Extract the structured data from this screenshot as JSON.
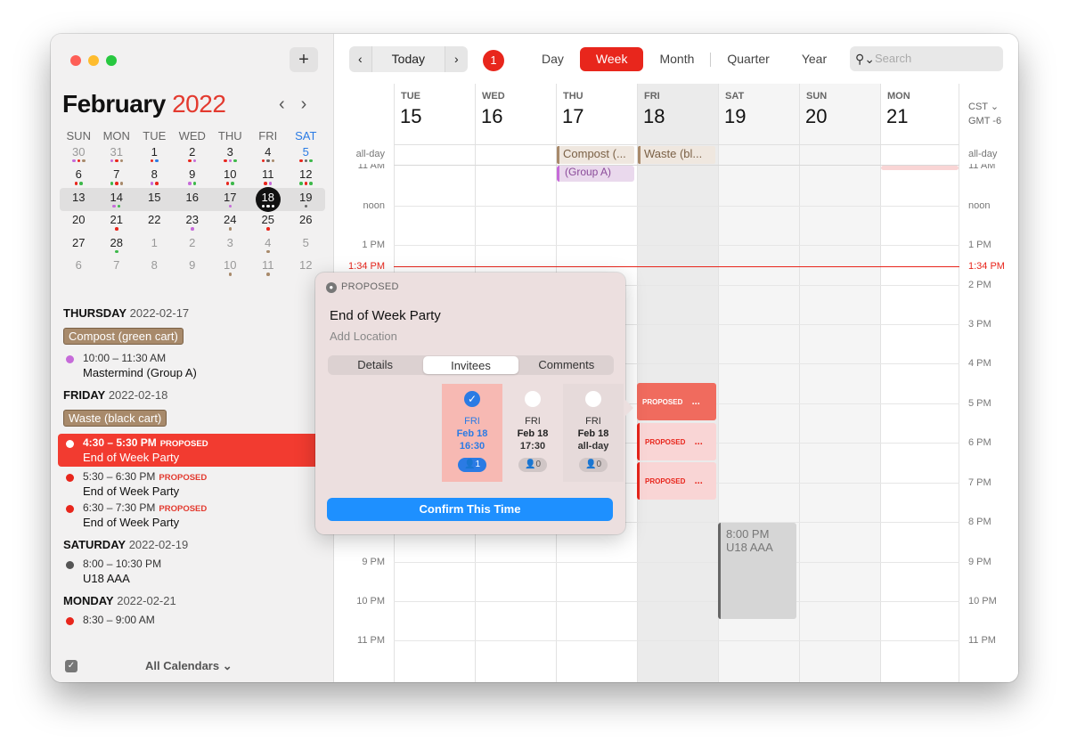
{
  "sidebar": {
    "add_label": "+",
    "month": "February",
    "year": "2022",
    "prev": "‹",
    "next": "›",
    "weekday_headers": [
      "SUN",
      "MON",
      "TUE",
      "WED",
      "THU",
      "FRI",
      "SAT"
    ],
    "weeks": [
      [
        {
          "d": "30",
          "out": true,
          "dots": [
            "#c66bd9",
            "#e8261c",
            "#a88a6b"
          ]
        },
        {
          "d": "31",
          "out": true,
          "dots": [
            "#c66bd9",
            "#e8261c",
            "#a88a6b"
          ]
        },
        {
          "d": "1",
          "dots": [
            "#e8261c",
            "#2b7be4"
          ]
        },
        {
          "d": "2",
          "dots": [
            "#e8261c",
            "#c66bd9"
          ]
        },
        {
          "d": "3",
          "dots": [
            "#e8261c",
            "#c66bd9",
            "#3db84a"
          ]
        },
        {
          "d": "4",
          "dots": [
            "#e8261c",
            "#666",
            "#a88a6b"
          ]
        },
        {
          "d": "5",
          "sat": true,
          "dots": [
            "#e8261c",
            "#666",
            "#3db84a"
          ]
        }
      ],
      [
        {
          "d": "6",
          "dots": [
            "#e8261c",
            "#3db84a"
          ]
        },
        {
          "d": "7",
          "dots": [
            "#3db84a",
            "#e8261c",
            "#a88a6b"
          ]
        },
        {
          "d": "8",
          "dots": [
            "#c66bd9",
            "#e8261c"
          ]
        },
        {
          "d": "9",
          "dots": [
            "#c66bd9",
            "#3db84a"
          ]
        },
        {
          "d": "10",
          "dots": [
            "#e8261c",
            "#3db84a"
          ]
        },
        {
          "d": "11",
          "dots": [
            "#e8261c",
            "#c66bd9"
          ]
        },
        {
          "d": "12",
          "dots": [
            "#3db84a",
            "#e8261c",
            "#3db84a"
          ]
        }
      ],
      [
        {
          "d": "13",
          "dots": []
        },
        {
          "d": "14",
          "dots": [
            "#c66bd9",
            "#3db84a"
          ]
        },
        {
          "d": "15",
          "dots": []
        },
        {
          "d": "16",
          "dots": []
        },
        {
          "d": "17",
          "dots": [
            "#c66bd9"
          ]
        },
        {
          "d": "18",
          "today": true,
          "dots": [
            "#fff",
            "#fff",
            "#fff"
          ]
        },
        {
          "d": "19",
          "dots": [
            "#666"
          ]
        }
      ],
      [
        {
          "d": "20",
          "dots": []
        },
        {
          "d": "21",
          "dots": [
            "#e8261c"
          ]
        },
        {
          "d": "22",
          "dots": []
        },
        {
          "d": "23",
          "dots": [
            "#c66bd9"
          ]
        },
        {
          "d": "24",
          "dots": [
            "#a88a6b"
          ]
        },
        {
          "d": "25",
          "dots": [
            "#e8261c"
          ]
        },
        {
          "d": "26",
          "dots": []
        }
      ],
      [
        {
          "d": "27",
          "dots": []
        },
        {
          "d": "28",
          "dots": [
            "#3db84a"
          ]
        },
        {
          "d": "1",
          "out": true,
          "dots": []
        },
        {
          "d": "2",
          "out": true,
          "dots": []
        },
        {
          "d": "3",
          "out": true,
          "dots": []
        },
        {
          "d": "4",
          "out": true,
          "dots": [
            "#a88a6b"
          ]
        },
        {
          "d": "5",
          "out": true,
          "dots": []
        }
      ],
      [
        {
          "d": "6",
          "out": true,
          "dots": []
        },
        {
          "d": "7",
          "out": true,
          "dots": []
        },
        {
          "d": "8",
          "out": true,
          "dots": []
        },
        {
          "d": "9",
          "out": true,
          "dots": []
        },
        {
          "d": "10",
          "out": true,
          "dots": [
            "#a88a6b"
          ]
        },
        {
          "d": "11",
          "out": true,
          "dots": [
            "#a88a6b"
          ]
        },
        {
          "d": "12",
          "out": true,
          "dots": []
        }
      ]
    ],
    "agenda": {
      "thu_name": "THURSDAY",
      "thu_date": "2022-02-17",
      "thu_tag": "Compost (green cart)",
      "thu_ev_time": "10:00 – 11:30 AM",
      "thu_ev_title": "Mastermind (Group A)",
      "fri_name": "FRIDAY",
      "fri_date": "2022-02-18",
      "fri_tag": "Waste (black cart)",
      "fri_ev1_time": "4:30 – 5:30 PM",
      "fri_ev1_title": "End of Week Party",
      "fri_ev2_time": "5:30 – 6:30 PM",
      "fri_ev2_title": "End of Week Party",
      "fri_ev3_time": "6:30 – 7:30 PM",
      "fri_ev3_title": "End of Week Party",
      "proposed": "PROPOSED",
      "sat_name": "SATURDAY",
      "sat_date": "2022-02-19",
      "sat_ev_time": "8:00 – 10:30 PM",
      "sat_ev_title": "U18 AAA",
      "mon_name": "MONDAY",
      "mon_date": "2022-02-21",
      "mon_ev_time": "8:30 – 9:00 AM"
    },
    "all_calendars": "All Calendars ⌄"
  },
  "toolbar": {
    "prev": "‹",
    "today": "Today",
    "next": "›",
    "badge": "1",
    "views": [
      "Day",
      "Week",
      "Month",
      "Quarter",
      "Year"
    ],
    "active_view": "Week",
    "search_placeholder": "Search"
  },
  "week": {
    "days": [
      {
        "name": "TUE",
        "num": "15"
      },
      {
        "name": "WED",
        "num": "16"
      },
      {
        "name": "THU",
        "num": "17"
      },
      {
        "name": "FRI",
        "num": "18"
      },
      {
        "name": "SAT",
        "num": "19"
      },
      {
        "name": "SUN",
        "num": "20"
      },
      {
        "name": "MON",
        "num": "21"
      }
    ],
    "tz1": "CST ⌄",
    "tz2": "GMT -6",
    "allday_label": "all-day",
    "allday_events": [
      "Compost (...",
      "Waste (bl..."
    ],
    "mm_text": "(Group A)",
    "time_labels": {
      "11am": "11 AM",
      "noon": "noon",
      "1pm": "1 PM",
      "now": "1:34 PM",
      "2pm": "2 PM",
      "3pm": "3 PM",
      "4pm": "4 PM",
      "5pm": "5 PM",
      "6pm": "6 PM",
      "7pm": "7 PM",
      "8pm": "8 PM",
      "9pm": "9 PM",
      "10pm": "10 PM",
      "11pm": "11 PM"
    },
    "u18_time": "8:00 PM",
    "u18_title": "U18 AAA",
    "prop_label": "PROPOSED",
    "more": "..."
  },
  "popover": {
    "status": "PROPOSED",
    "title": "End of Week Party",
    "location": "Add Location",
    "tabs": [
      "Details",
      "Invitees",
      "Comments"
    ],
    "active_tab": "Invitees",
    "options": [
      {
        "dow": "FRI",
        "date": "Feb 18",
        "time": "16:30",
        "count": "1"
      },
      {
        "dow": "FRI",
        "date": "Feb 18",
        "time": "17:30",
        "count": "0"
      },
      {
        "dow": "FRI",
        "date": "Feb 18",
        "time": "all-day",
        "count": "0"
      }
    ],
    "confirm": "Confirm This Time"
  }
}
